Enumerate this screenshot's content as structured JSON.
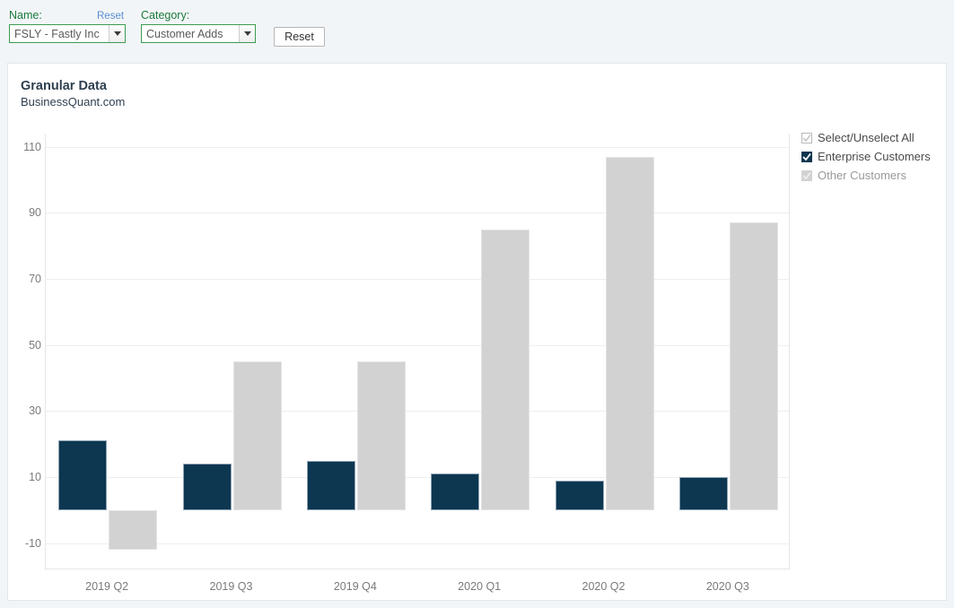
{
  "controls": {
    "name_label": "Name:",
    "name_reset_label": "Reset",
    "name_value": "FSLY - Fastly Inc",
    "category_label": "Category:",
    "category_value": "Customer Adds",
    "reset_button_label": "Reset"
  },
  "chart_header": {
    "title": "Granular Data",
    "subtitle": "BusinessQuant.com"
  },
  "legend": {
    "items": [
      {
        "label": "Select/Unselect All",
        "state": "partial",
        "color": "#ffffff"
      },
      {
        "label": "Enterprise Customers",
        "state": "checked",
        "color": "#0d3650"
      },
      {
        "label": "Other Customers",
        "state": "unchecked",
        "color": "#d2d2d2"
      }
    ]
  },
  "chart_data": {
    "type": "bar",
    "title": "Granular Data",
    "subtitle": "BusinessQuant.com",
    "xlabel": "",
    "ylabel": "",
    "categories": [
      "2019 Q2",
      "2019 Q3",
      "2019 Q4",
      "2020 Q1",
      "2020 Q2",
      "2020 Q3"
    ],
    "series": [
      {
        "name": "Enterprise Customers",
        "color": "#0d3650",
        "values": [
          21,
          14,
          15,
          11,
          9,
          10
        ]
      },
      {
        "name": "Other Customers",
        "color": "#d2d2d2",
        "values": [
          -12,
          45,
          45,
          85,
          107,
          87
        ]
      }
    ],
    "ylim": [
      -18,
      114
    ],
    "yticks": [
      110,
      90,
      70,
      50,
      30,
      10,
      -10
    ],
    "grid": true,
    "legend_position": "right"
  }
}
